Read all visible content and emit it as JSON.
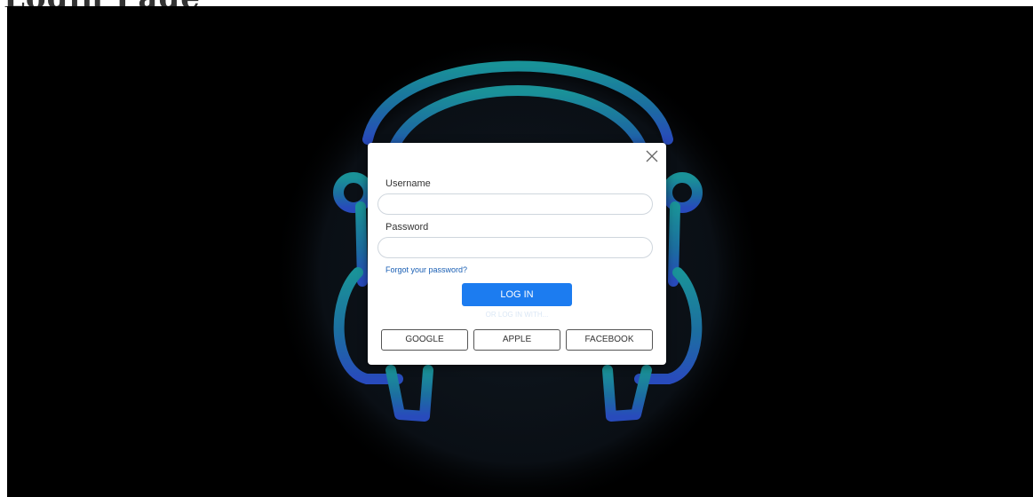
{
  "page": {
    "title": "Login Page"
  },
  "modal": {
    "close_icon": "close-icon",
    "username": {
      "label": "Username",
      "value": "",
      "placeholder": ""
    },
    "password": {
      "label": "Password",
      "value": "",
      "placeholder": ""
    },
    "forgot_password": "Forgot your password?",
    "login_button": "LOG IN",
    "or_text": "OR LOG IN WITH...",
    "social_buttons": [
      "GOOGLE",
      "APPLE",
      "FACEBOOK"
    ]
  },
  "colors": {
    "backdrop": "#000000",
    "accent_button": "#1c7cf0",
    "link": "#1a5fb4",
    "headphone_gradient_start": "#1fa3a8",
    "headphone_gradient_end": "#2a50c8"
  },
  "background": {
    "graphic": "headphones-logo-icon"
  }
}
